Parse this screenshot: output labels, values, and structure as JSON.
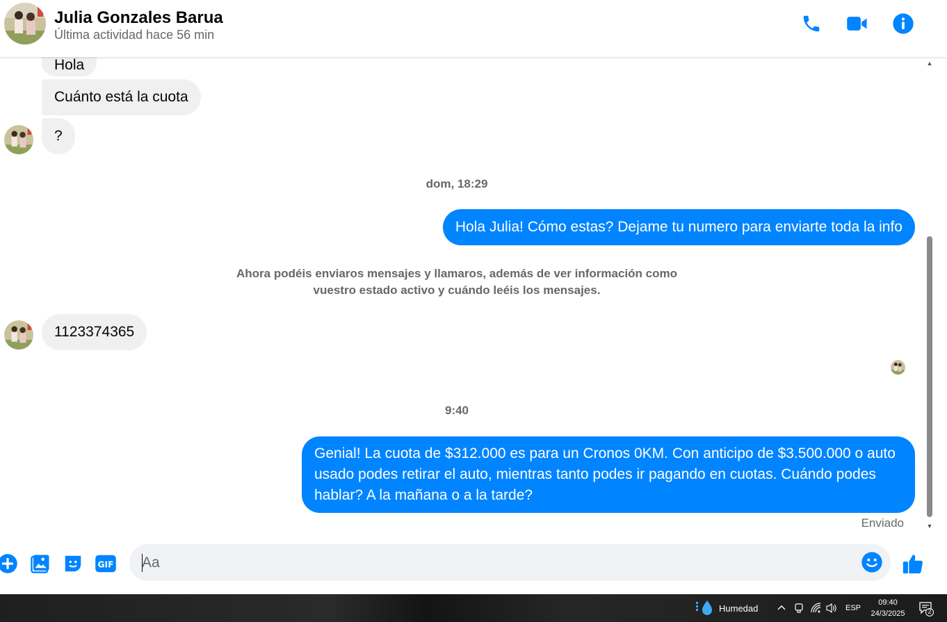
{
  "header": {
    "contact_name": "Julia Gonzales Barua",
    "last_active": "Última actividad hace 56 min",
    "icons": [
      "phone-icon",
      "video-icon",
      "info-icon"
    ],
    "accent_color": "#0084ff"
  },
  "messages": {
    "incoming_1": "Hola",
    "incoming_2": "Cuánto  está la cuota",
    "incoming_3": "?",
    "timestamp_1": "dom, 18:29",
    "outgoing_1": "Hola Julia! Cómo estas? Dejame tu numero para enviarte toda la info",
    "system_line_1": "Ahora podéis enviaros mensajes y llamaros, además de ver información como",
    "system_line_2": "vuestro estado activo y cuándo leéis los mensajes.",
    "incoming_4": "1123374365",
    "timestamp_2": "9:40",
    "outgoing_2": "Genial! La cuota de $312.000 es para un Cronos 0KM. Con anticipo de $3.500.000 o auto usado podes retirar el auto, mientras tanto podes ir pagando en cuotas. Cuándo podes hablar? A la mañana o a la tarde?",
    "status": "Enviado"
  },
  "composer": {
    "placeholder": "Aa",
    "icons": [
      "plus-icon",
      "image-icon",
      "sticker-icon",
      "gif-icon",
      "emoji-icon",
      "like-icon"
    ],
    "gif_label": "GIF"
  },
  "taskbar": {
    "weather_label": "Humedad",
    "language": "ESP",
    "time": "09:40",
    "date": "24/3/2025",
    "notification_count": "2"
  }
}
